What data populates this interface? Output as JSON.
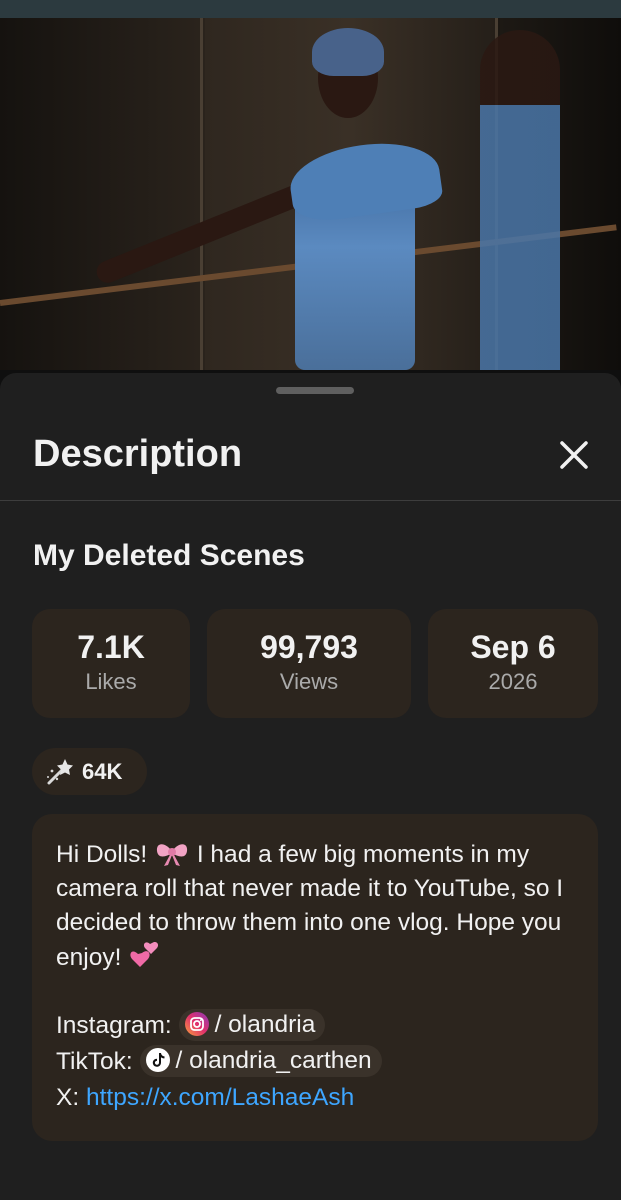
{
  "sheet": {
    "title": "Description"
  },
  "video": {
    "title": "My Deleted Scenes"
  },
  "stats": {
    "likes": {
      "value": "7.1K",
      "label": "Likes"
    },
    "views": {
      "value": "99,793",
      "label": "Views"
    },
    "date": {
      "value": "Sep 6",
      "label": "2026"
    }
  },
  "remix_chip": {
    "icon": "magic-wand-icon",
    "count": "64K"
  },
  "description": {
    "line1_pre": "Hi Dolls! ",
    "line1_post": " I had a few big moments in my camera roll that never made it to YouTube, so I decided to throw them into one vlog. Hope you enjoy! ",
    "emoji1": "ribbon-emoji",
    "emoji2": "two-hearts-emoji",
    "instagram_label": "Instagram: ",
    "instagram_handle": "/ olandria",
    "tiktok_label": "TikTok: ",
    "tiktok_handle": "/ olandria_carthen",
    "x_label": "X: ",
    "x_link": "https://x.com/LashaeAsh"
  },
  "colors": {
    "background": "#1f1f1f",
    "card": "#2c251e",
    "link": "#3ea6ff",
    "secondary_text": "#aaaaaa"
  }
}
